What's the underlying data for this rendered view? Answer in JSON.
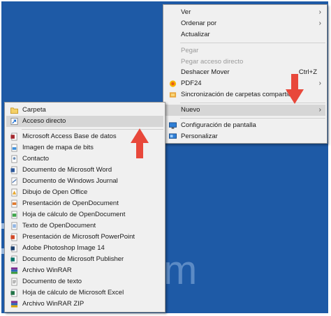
{
  "context_menu": {
    "items": [
      {
        "label": "Ver"
      },
      {
        "label": "Ordenar por"
      },
      {
        "label": "Actualizar"
      },
      {
        "label": "Pegar"
      },
      {
        "label": "Pegar acceso directo"
      },
      {
        "label": "Deshacer Mover",
        "shortcut": "Ctrl+Z"
      },
      {
        "label": "PDF24"
      },
      {
        "label": "Sincronización de carpetas compartidas"
      },
      {
        "label": "Nuevo"
      },
      {
        "label": "Configuración de pantalla"
      },
      {
        "label": "Personalizar"
      }
    ]
  },
  "submenu": {
    "items": [
      {
        "label": "Carpeta"
      },
      {
        "label": "Acceso directo"
      },
      {
        "label": "Microsoft Access Base de datos"
      },
      {
        "label": "Imagen de mapa de bits"
      },
      {
        "label": "Contacto"
      },
      {
        "label": "Documento de Microsoft Word"
      },
      {
        "label": "Documento de Windows Journal"
      },
      {
        "label": "Dibujo de Open Office"
      },
      {
        "label": "Presentación de OpenDocument"
      },
      {
        "label": "Hoja de cálculo de OpenDocument"
      },
      {
        "label": "Texto de OpenDocument"
      },
      {
        "label": "Presentación de Microsoft PowerPoint"
      },
      {
        "label": "Adobe Photoshop Image 14"
      },
      {
        "label": "Documento de Microsoft Publisher"
      },
      {
        "label": "Archivo WinRAR"
      },
      {
        "label": "Documento de texto"
      },
      {
        "label": "Hoja de cálculo de Microsoft Excel"
      },
      {
        "label": "Archivo WinRAR ZIP"
      }
    ]
  },
  "desktop": {
    "partial_text": "m"
  },
  "colors": {
    "desktop": "#1e5aa6",
    "menu": "#f0f0f0",
    "highlight": "#d6d6d6",
    "arrow": "#e8483b"
  }
}
